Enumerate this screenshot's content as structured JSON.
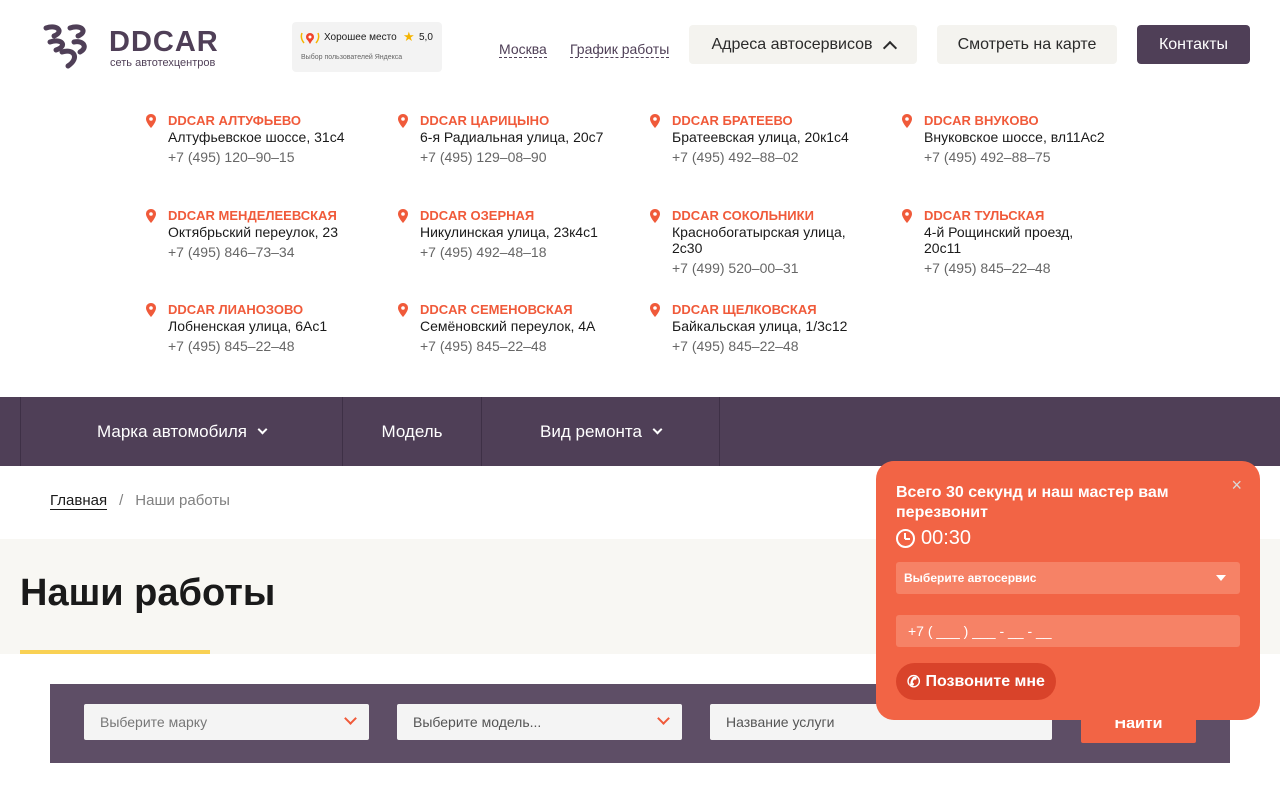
{
  "header": {
    "logo_name": "DDCAR",
    "logo_sub": "сеть автотехцентров",
    "rating": {
      "label": "Хорошее место",
      "score": "5,0",
      "sub": "Выбор пользователей Яндекса"
    },
    "links": [
      "Москва",
      "График работы"
    ],
    "addresses_button": "Адреса автосервисов",
    "map_button": "Смотреть на карте",
    "contacts_button": "Контакты"
  },
  "addresses": [
    {
      "name": "DDCAR АЛТУФЬЕВО",
      "street": "Алтуфьевское шоссе, 31с4",
      "phone": "+7 (495) 120–90–15"
    },
    {
      "name": "DDCAR ЦАРИЦЫНО",
      "street": "6-я Радиальная улица, 20с7",
      "phone": "+7 (495) 129–08–90"
    },
    {
      "name": "DDCAR БРАТЕЕВО",
      "street": "Братеевская улица, 20к1с4",
      "phone": "+7 (495) 492–88–02"
    },
    {
      "name": "DDCAR ВНУКОВО",
      "street": "Внуковское шоссе, вл11Ас2",
      "phone": "+7 (495) 492–88–75"
    },
    {
      "name": "DDCAR МЕНДЕЛЕЕВСКАЯ",
      "street": "Октябрьский переулок, 23",
      "phone": "+7 (495) 846–73–34"
    },
    {
      "name": "DDCAR ОЗЕРНАЯ",
      "street": "Никулинская улица, 23к4с1",
      "phone": "+7 (495) 492–48–18"
    },
    {
      "name": "DDCAR СОКОЛЬНИКИ",
      "street": "Краснобогатырская улица, 2с30",
      "phone": "+7 (499) 520–00–31"
    },
    {
      "name": "DDCAR ТУЛЬСКАЯ",
      "street": "4-й Рощинский проезд, 20с11",
      "phone": "+7 (495) 845–22–48"
    },
    {
      "name": "DDCAR ЛИАНОЗОВО",
      "street": "Лобненская улица, 6Ас1",
      "phone": "+7 (495) 845–22–48"
    },
    {
      "name": "DDCAR СЕМЕНОВСКАЯ",
      "street": "Семёновский переулок, 4А",
      "phone": "+7 (495) 845–22–48"
    },
    {
      "name": "DDCAR ЩЕЛКОВСКАЯ",
      "street": "Байкальская улица, 1/3с12",
      "phone": "+7 (495) 845–22–48"
    }
  ],
  "filters": {
    "brand": "Марка автомобиля",
    "model": "Модель",
    "repair": "Вид ремонта"
  },
  "breadcrumb": {
    "home": "Главная",
    "separator": "/",
    "current": "Наши работы"
  },
  "page_title": "Наши работы",
  "search": {
    "brand_placeholder": "Выберите марку",
    "model_placeholder": "Выберите модель...",
    "service_placeholder": "Название услуги",
    "submit": "Найти"
  },
  "popup": {
    "close": "×",
    "title": "Всего 30 секунд и наш мастер вам перезвонит",
    "timer": "00:30",
    "select_placeholder": "Выберите автосервис",
    "phone_placeholder": "+7 ( ___ ) ___ - __ - __",
    "call_button": "Позвоните мне"
  },
  "colors": {
    "brand_purple": "#4f3f57",
    "accent_orange": "#f26445",
    "title_underline": "#f9d154"
  }
}
